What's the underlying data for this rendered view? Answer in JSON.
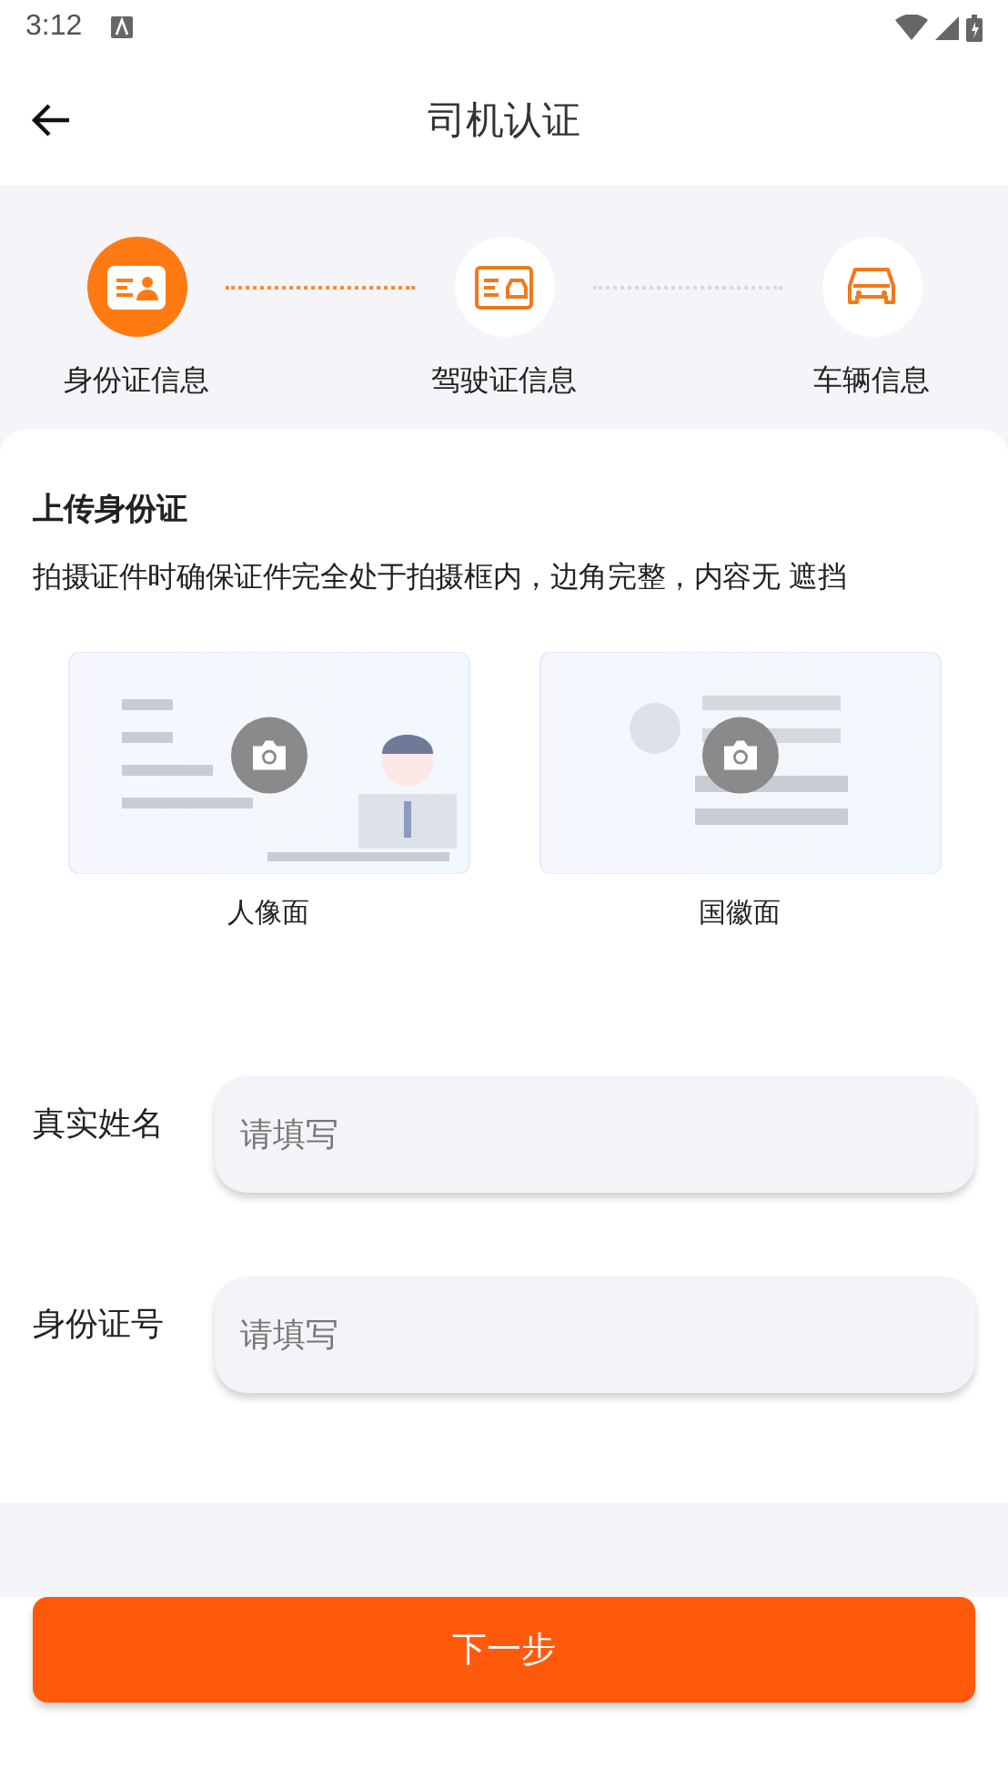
{
  "status_bar": {
    "time": "3:12"
  },
  "header": {
    "title": "司机认证"
  },
  "steps": [
    {
      "label": "身份证信息",
      "kind": "id",
      "selected": true
    },
    {
      "label": "驾驶证信息",
      "kind": "license",
      "selected": false
    },
    {
      "label": "车辆信息",
      "kind": "car",
      "selected": false
    }
  ],
  "upload": {
    "title": "上传身份证",
    "hint": "拍摄证件时确保证件完全处于拍摄框内，边角完整，内容无 遮挡",
    "sides": [
      {
        "kind": "portrait",
        "label": "人像面"
      },
      {
        "kind": "emblem",
        "label": "国徽面"
      }
    ]
  },
  "fields": [
    {
      "label": "真实姓名",
      "placeholder": "请填写"
    },
    {
      "label": "身份证号",
      "placeholder": "请填写"
    }
  ],
  "next_button": "下一步"
}
